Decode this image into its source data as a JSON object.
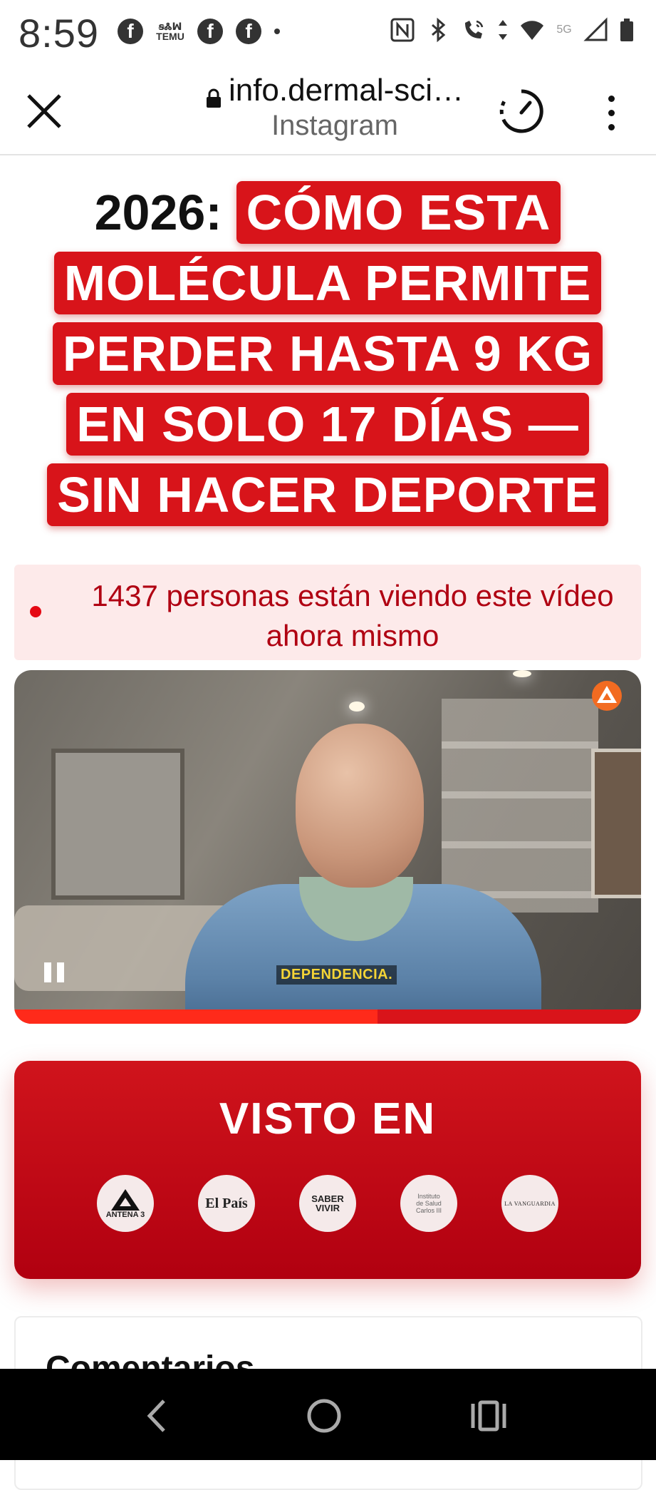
{
  "status_bar": {
    "time": "8:59",
    "left_icons": [
      "facebook-icon",
      "temu-icon",
      "facebook-icon",
      "facebook-icon"
    ],
    "temu_top": "ꞩᏜꟽ",
    "temu_label": "TEMU",
    "right_icons": [
      "nfc-icon",
      "bluetooth-icon",
      "wifi-call-icon",
      "data-arrows-icon",
      "wifi-icon",
      "signal-5g-icon",
      "signal-icon",
      "battery-icon"
    ],
    "network_label": "5G"
  },
  "browser": {
    "url": "info.dermal-sci…",
    "subtitle": "Instagram"
  },
  "headline": {
    "year": "2026:",
    "lines": [
      "CÓMO ESTA",
      "MOLÉCULA PERMITE",
      "PERDER HASTA 9 KG",
      "EN SOLO 17 DÍAS —",
      "SIN HACER DEPORTE"
    ],
    "highlight_color": "#d8141a"
  },
  "viewers": {
    "text": "1437 personas están viendo este vídeo ahora mismo"
  },
  "video": {
    "caption": "DEPENDENCIA.",
    "progress": 0.58,
    "state": "playing"
  },
  "seen_in": {
    "title": "VISTO EN",
    "logos": {
      "antena3": "ANTENA 3",
      "elpais": "El País",
      "saber_top": "SABER",
      "saber_bottom": "VIVIR",
      "isc_1": "Instituto",
      "isc_2": "de Salud",
      "isc_3": "Carlos III",
      "lavanguardia": "LA VANGUARDIA"
    }
  },
  "comments": {
    "title": "Comentarios"
  },
  "navbar": {
    "buttons": [
      "back-icon",
      "home-icon",
      "recents-icon"
    ]
  }
}
